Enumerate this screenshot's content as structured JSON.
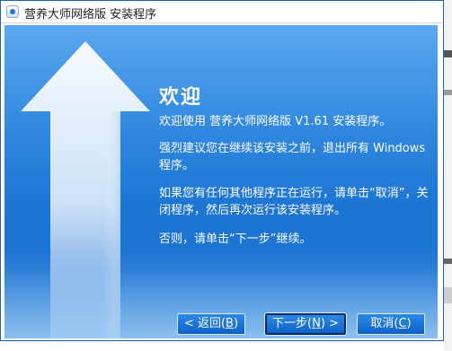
{
  "window": {
    "title": "营养大师网络版 安装程序"
  },
  "welcome": {
    "heading": "欢迎",
    "line1": "欢迎使用 营养大师网络版 V1.61 安装程序。",
    "line2": "强烈建议您在继续该安装之前，退出所有 Windows 程序。",
    "line3": "如果您有任何其他程序正在运行，请单击“取消”，关闭程序，然后再次运行该安装程序。",
    "line4": "否则，请单击“下一步”继续。"
  },
  "buttons": {
    "back_prefix": "< 返回(",
    "back_key": "B",
    "back_suffix": ")",
    "next_prefix": "下一步(",
    "next_key": "N",
    "next_suffix": ") >",
    "cancel_prefix": "取消(",
    "cancel_key": "C",
    "cancel_suffix": ")"
  },
  "colors": {
    "panel_blue": "#1c74d3",
    "button_blue": "#1f7ad9",
    "title_text": "#1f1f1f"
  },
  "icons": {
    "app": "installer-app-icon",
    "decoration": "up-arrow-graphic"
  }
}
